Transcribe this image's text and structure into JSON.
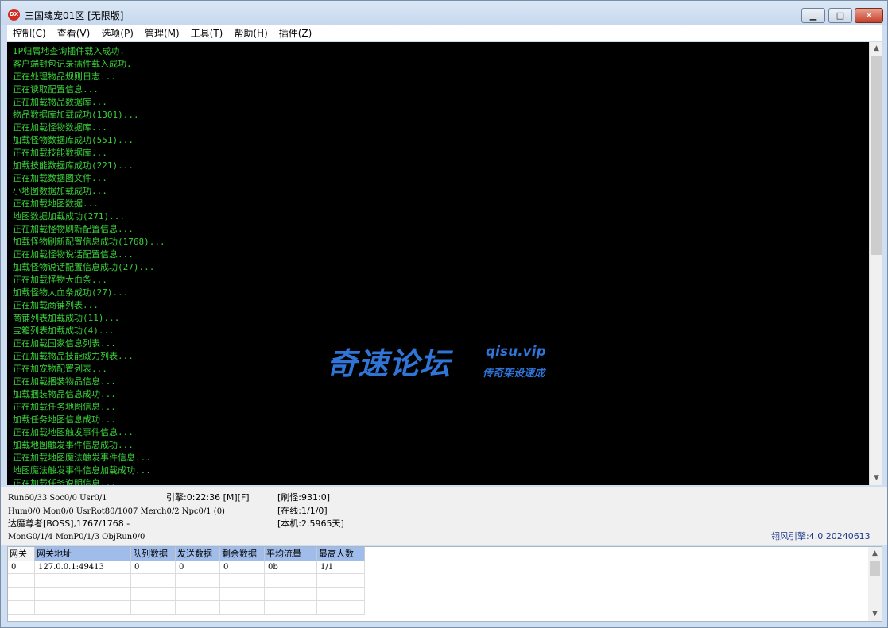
{
  "window": {
    "title": "三国魂宠01区 [无限版]",
    "icon_label": "DX",
    "controls": [
      "minimize-icon",
      "maximize-icon",
      "close-icon"
    ]
  },
  "menu": [
    "控制(C)",
    "查看(V)",
    "选项(P)",
    "管理(M)",
    "工具(T)",
    "帮助(H)",
    "插件(Z)"
  ],
  "log": {
    "lines": [
      "IP归属地查询插件载入成功.",
      "客户端封包记录插件载入成功.",
      "正在处理物品规则日志...",
      "正在读取配置信息...",
      "正在加载物品数据库...",
      "物品数据库加载成功(1301)...",
      "正在加载怪物数据库...",
      "加载怪物数据库成功(551)...",
      "正在加载技能数据库...",
      "加载技能数据库成功(221)...",
      "正在加载数据图文件...",
      "小地图数据加载成功...",
      "正在加载地图数据...",
      "地图数据加载成功(271)...",
      "正在加载怪物刷新配置信息...",
      "加载怪物刷新配置信息成功(1768)...",
      "正在加载怪物说话配置信息...",
      "加载怪物说话配置信息成功(27)...",
      "正在加载怪物大血条...",
      "加载怪物大血条成功(27)...",
      "正在加载商铺列表...",
      "商铺列表加载成功(11)...",
      "宝箱列表加载成功(4)...",
      "正在加载国家信息列表...",
      "正在加载物品技能威力列表...",
      "正在加宠物配置列表...",
      "正在加载捆装物品信息...",
      "加载捆装物品信息成功...",
      "正在加载任务地图信息...",
      "加载任务地图信息成功...",
      "正在加载地图触发事件信息...",
      "加载地图触发事件信息成功...",
      "正在加载地图魔法触发事件信息...",
      "地图魔法触发事件信息加载成功...",
      "正在加载任务说明信息..."
    ],
    "color": "#3ad13a",
    "background": "#000000"
  },
  "watermark": {
    "main": "奇速论坛",
    "site": "qisu.vip",
    "sub": "传奇架设速成"
  },
  "status": {
    "run_stats": "Run60/33 Soc0/0 Usr0/1",
    "engine_time": "引擎:0:22:36 [M][F]",
    "refresh_monsters": "[刷怪:931:0]",
    "hum_stats": "Hum0/0 Mon0/0 UsrRot80/1007 Merch0/2 Npc0/1 (0)",
    "online": "[在线:1/1/0]",
    "boss_info": "达魔尊者[BOSS],1767/1768 -",
    "uptime": "[本机:2.5965天]",
    "mon_gen": "MonG0/1/4 MonP0/1/3 ObjRun0/0",
    "engine_version": "翎风引擎:4.0 20240613"
  },
  "gateway_table": {
    "headers": [
      "网关",
      "网关地址",
      "队列数据",
      "发送数据",
      "剩余数据",
      "平均流量",
      "最高人数"
    ],
    "rows": [
      [
        "0",
        "127.0.0.1:49413",
        "0",
        "0",
        "0",
        "0b",
        "1/1"
      ]
    ]
  },
  "colors": {
    "window_frame": "#cfdff1",
    "selected_header": "#9fbcea",
    "watermark": "#2f74d6",
    "engine_version": "#1c3a8a"
  }
}
